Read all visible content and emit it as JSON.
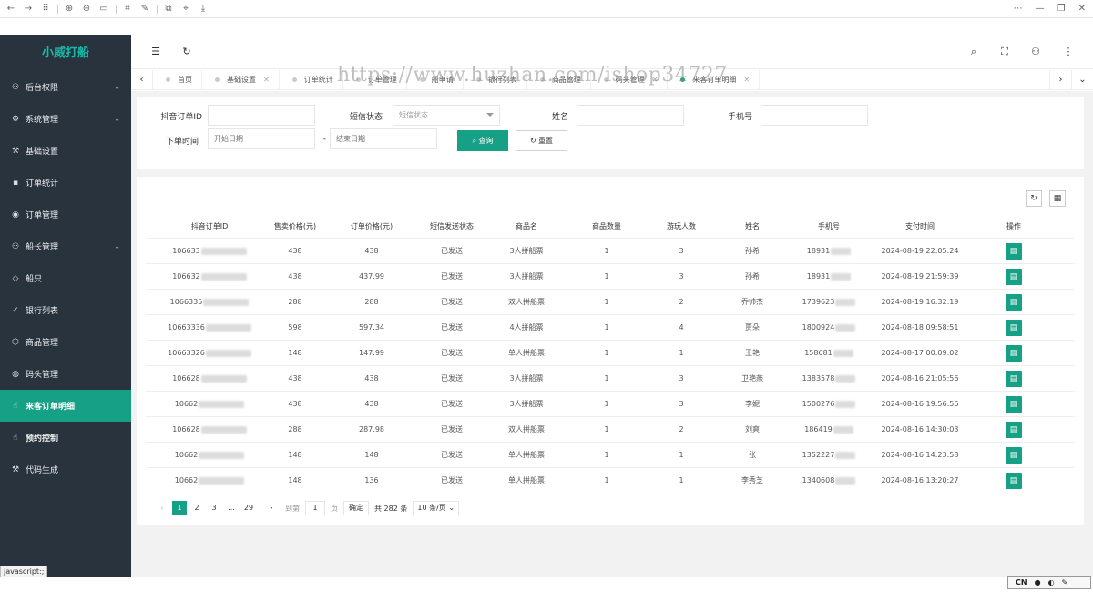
{
  "sidebar": {
    "logo": "小威打船",
    "items": [
      {
        "label": "后台权限",
        "icon": "user-icon",
        "glyph": "⚇",
        "chevron": true
      },
      {
        "label": "系统管理",
        "icon": "gear-icon",
        "glyph": "⚙",
        "chevron": true
      },
      {
        "label": "基础设置",
        "icon": "tools-icon",
        "glyph": "⚒",
        "chevron": false
      },
      {
        "label": "订单统计",
        "icon": "chat-icon",
        "glyph": "▪",
        "chevron": false
      },
      {
        "label": "订单管理",
        "icon": "target-icon",
        "glyph": "◉",
        "chevron": false
      },
      {
        "label": "船长管理",
        "icon": "users-icon",
        "glyph": "⚇",
        "chevron": true
      },
      {
        "label": "船只",
        "icon": "diamond-icon",
        "glyph": "◇",
        "chevron": false
      },
      {
        "label": "银行列表",
        "icon": "shield-check-icon",
        "glyph": "✓",
        "chevron": false
      },
      {
        "label": "商品管理",
        "icon": "cube-icon",
        "glyph": "⬡",
        "chevron": false
      },
      {
        "label": "码头管理",
        "icon": "fire-icon",
        "glyph": "◍",
        "chevron": false
      },
      {
        "label": "来客订单明细",
        "icon": "hand-icon",
        "glyph": "☝",
        "chevron": false,
        "active": true
      },
      {
        "label": "预约控制",
        "icon": "hand-icon",
        "glyph": "☝",
        "chevron": false
      },
      {
        "label": "代码生成",
        "icon": "tools-icon",
        "glyph": "⚒",
        "chevron": false
      }
    ]
  },
  "status_tip": "javascript:;",
  "tabs": [
    {
      "label": "首页"
    },
    {
      "label": "基础设置",
      "closable": true
    },
    {
      "label": "订单统计"
    },
    {
      "label": "订单管理"
    },
    {
      "label": "船申请"
    },
    {
      "label": "银行列表"
    },
    {
      "label": "商品管理"
    },
    {
      "label": "码头管理",
      "closable": true
    },
    {
      "label": "来客订单明细",
      "closable": true,
      "active": true
    }
  ],
  "watermark": "https://www.huzhan.com/ishop34727",
  "search": {
    "order_id_label": "抖音订单ID",
    "sms_label": "短信状态",
    "sms_placeholder": "短信状态",
    "name_label": "姓名",
    "phone_label": "手机号",
    "time_label": "下单时间",
    "start_placeholder": "开始日期",
    "range_sep": "-",
    "end_placeholder": "结束日期",
    "query_button": "查询",
    "reset_button": "重置"
  },
  "table": {
    "columns": [
      "抖音订单ID",
      "售卖价格(元)",
      "订单价格(元)",
      "短信发送状态",
      "商品名",
      "商品数量",
      "游玩人数",
      "姓名",
      "手机号",
      "支付时间",
      "操作"
    ],
    "rows": [
      {
        "id": "106633",
        "sale": "438",
        "price": "438",
        "sms": "已发送",
        "product": "3人拼船票",
        "qty": "1",
        "people": "3",
        "name": "孙希",
        "phone": "18931",
        "time": "2024-08-19 22:05:24"
      },
      {
        "id": "106632",
        "sale": "438",
        "price": "437.99",
        "sms": "已发送",
        "product": "3人拼船票",
        "qty": "1",
        "people": "3",
        "name": "孙希",
        "phone": "18931",
        "time": "2024-08-19 21:59:39"
      },
      {
        "id": "1066335",
        "sale": "288",
        "price": "288",
        "sms": "已发送",
        "product": "双人拼船票",
        "qty": "1",
        "people": "2",
        "name": "乔帅杰",
        "phone": "1739623",
        "time": "2024-08-19 16:32:19"
      },
      {
        "id": "10663336",
        "sale": "598",
        "price": "597.34",
        "sms": "已发送",
        "product": "4人拼船票",
        "qty": "1",
        "people": "4",
        "name": "贾朵",
        "phone": "1800924",
        "time": "2024-08-18 09:58:51"
      },
      {
        "id": "10663326",
        "sale": "148",
        "price": "147.99",
        "sms": "已发送",
        "product": "单人拼船票",
        "qty": "1",
        "people": "1",
        "name": "王艳",
        "phone": "158681",
        "time": "2024-08-17 00:09:02"
      },
      {
        "id": "106628",
        "sale": "438",
        "price": "438",
        "sms": "已发送",
        "product": "3人拼船票",
        "qty": "1",
        "people": "3",
        "name": "卫艳燕",
        "phone": "1383578",
        "time": "2024-08-16 21:05:56"
      },
      {
        "id": "10662",
        "sale": "438",
        "price": "438",
        "sms": "已发送",
        "product": "3人拼船票",
        "qty": "1",
        "people": "3",
        "name": "李妮",
        "phone": "1500276",
        "time": "2024-08-16 19:56:56"
      },
      {
        "id": "106628",
        "sale": "288",
        "price": "287.98",
        "sms": "已发送",
        "product": "双人拼船票",
        "qty": "1",
        "people": "2",
        "name": "刘爽",
        "phone": "186419",
        "time": "2024-08-16 14:30:03"
      },
      {
        "id": "10662",
        "sale": "148",
        "price": "148",
        "sms": "已发送",
        "product": "单人拼船票",
        "qty": "1",
        "people": "1",
        "name": "张",
        "phone": "1352227",
        "time": "2024-08-16 14:23:58"
      },
      {
        "id": "10662",
        "sale": "148",
        "price": "136",
        "sms": "已发送",
        "product": "单人拼船票",
        "qty": "1",
        "people": "1",
        "name": "李秀芝",
        "phone": "1340608",
        "time": "2024-08-16 13:20:27"
      }
    ]
  },
  "pager": {
    "prev": "‹",
    "pages": [
      "1",
      "2",
      "3"
    ],
    "ellipsis": "…",
    "last": "29",
    "next": "›",
    "goto_label": "到第",
    "goto_value": "1",
    "page_unit": "页",
    "confirm": "确定",
    "total": "共 282 条",
    "per_page": "10 条/页"
  },
  "ime": {
    "lang": "CN"
  },
  "colors": {
    "accent": "#16a085",
    "sidebar": "#28333e"
  }
}
